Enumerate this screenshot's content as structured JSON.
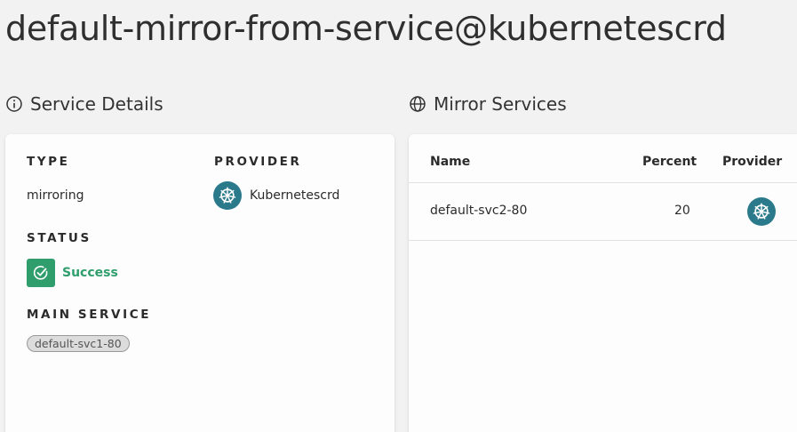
{
  "page": {
    "title": "default-mirror-from-service@kubernetescrd"
  },
  "sections": {
    "details": {
      "title": "Service Details",
      "icon": "info-icon"
    },
    "mirrors": {
      "title": "Mirror Services",
      "icon": "globe-icon"
    }
  },
  "details": {
    "type_label": "TYPE",
    "type_value": "mirroring",
    "provider_label": "PROVIDER",
    "provider_value": "Kubernetescrd",
    "provider_icon": "kubernetes-icon",
    "status_label": "STATUS",
    "status_value": "Success",
    "status_icon": "check-circle-icon",
    "main_service_label": "MAIN SERVICE",
    "main_service_value": "default-svc1-80"
  },
  "mirrors_table": {
    "columns": {
      "name": "Name",
      "percent": "Percent",
      "provider": "Provider"
    },
    "rows": [
      {
        "name": "default-svc2-80",
        "percent": "20",
        "provider_icon": "kubernetes-icon"
      }
    ]
  },
  "colors": {
    "background": "#f2f2f2",
    "card": "#fdfdfd",
    "success": "#2f9e6c",
    "kubernetes": "#2b7a8c"
  }
}
